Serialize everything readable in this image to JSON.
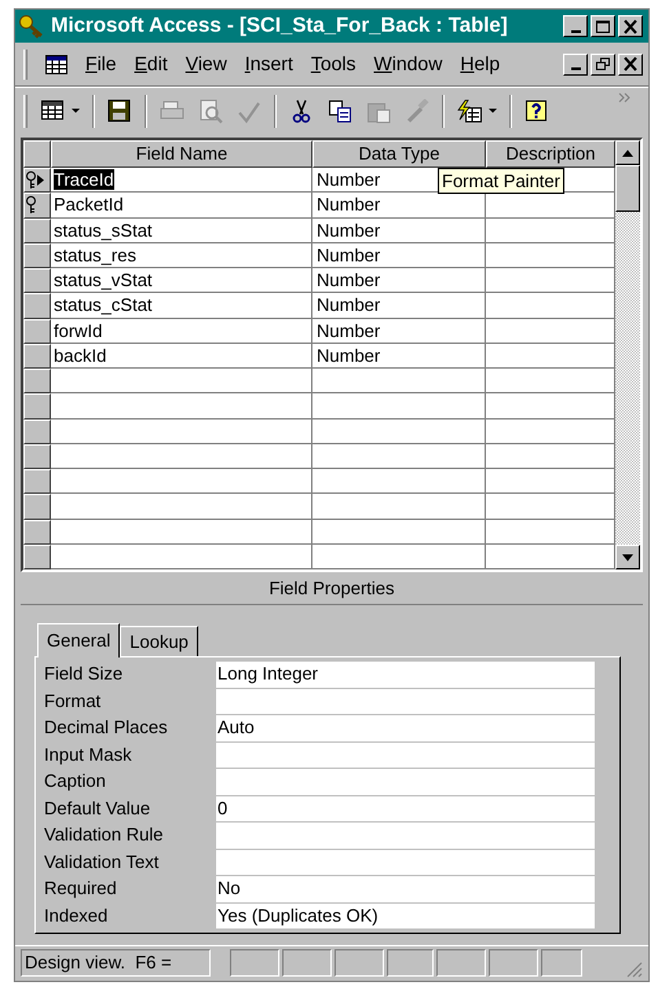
{
  "window": {
    "title": "Microsoft Access - [SCI_Sta_For_Back : Table]"
  },
  "menu": [
    "File",
    "Edit",
    "View",
    "Insert",
    "Tools",
    "Window",
    "Help"
  ],
  "toolbar": [
    {
      "kind": "view",
      "disabled": false,
      "dropdown": true
    },
    {
      "kind": "save",
      "disabled": false,
      "dropdown": false
    },
    {
      "kind": "print",
      "disabled": true,
      "dropdown": false
    },
    {
      "kind": "preview",
      "disabled": true,
      "dropdown": false
    },
    {
      "kind": "spelling",
      "disabled": true,
      "dropdown": false
    },
    {
      "kind": "cut",
      "disabled": false,
      "dropdown": false
    },
    {
      "kind": "copy",
      "disabled": false,
      "dropdown": false
    },
    {
      "kind": "paste",
      "disabled": true,
      "dropdown": false
    },
    {
      "kind": "brush",
      "disabled": true,
      "dropdown": false
    },
    {
      "kind": "build",
      "disabled": false,
      "dropdown": true
    },
    {
      "kind": "help",
      "disabled": false,
      "dropdown": false
    }
  ],
  "tooltip": "Format Painter",
  "table": {
    "columns": [
      "Field Name",
      "Data Type",
      "Description"
    ],
    "rows": [
      {
        "field": "TraceId",
        "type": "Number",
        "primary_key": true,
        "selected": true
      },
      {
        "field": "PacketId",
        "type": "Number",
        "primary_key": true,
        "selected": false
      },
      {
        "field": "status_sStat",
        "type": "Number",
        "primary_key": false,
        "selected": false
      },
      {
        "field": "status_res",
        "type": "Number",
        "primary_key": false,
        "selected": false
      },
      {
        "field": "status_vStat",
        "type": "Number",
        "primary_key": false,
        "selected": false
      },
      {
        "field": "status_cStat",
        "type": "Number",
        "primary_key": false,
        "selected": false
      },
      {
        "field": "forwId",
        "type": "Number",
        "primary_key": false,
        "selected": false
      },
      {
        "field": "backId",
        "type": "Number",
        "primary_key": false,
        "selected": false
      }
    ]
  },
  "field_properties": {
    "title": "Field Properties",
    "tabs": [
      {
        "label": "General",
        "selected": true
      },
      {
        "label": "Lookup",
        "selected": false
      }
    ],
    "properties": [
      {
        "label": "Field Size",
        "value": "Long Integer"
      },
      {
        "label": "Format"
      },
      {
        "label": "Decimal Places",
        "value": "Auto"
      },
      {
        "label": "Input Mask"
      },
      {
        "label": "Caption"
      },
      {
        "label": "Default Value",
        "value": "0"
      },
      {
        "label": "Validation Rule"
      },
      {
        "label": "Validation Text"
      },
      {
        "label": "Required",
        "value": "No"
      },
      {
        "label": "Indexed",
        "value": "Yes (Duplicates OK)"
      }
    ]
  },
  "status_bar": {
    "text": "Design view.  F6 ="
  }
}
